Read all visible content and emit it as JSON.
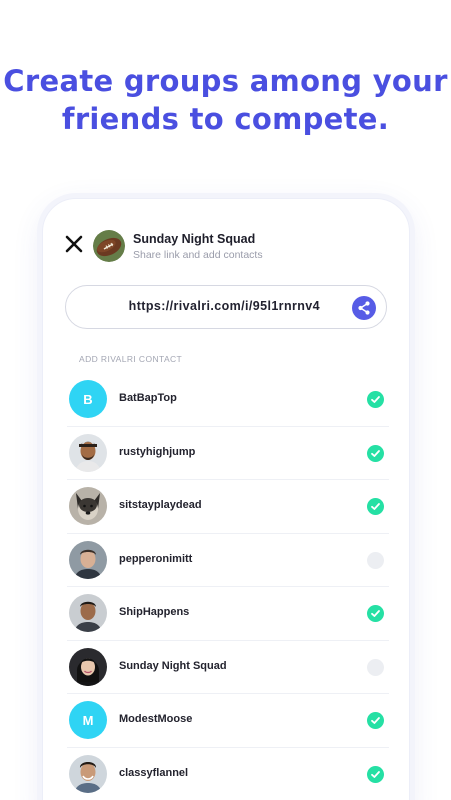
{
  "headline": {
    "line1": "Create groups among your",
    "line2": "friends to compete."
  },
  "group": {
    "name": "Sunday Night Squad",
    "subtitle": "Share link and add contacts",
    "avatar_icon": "football-icon"
  },
  "share_link": {
    "url": "https://rivalri.com/i/95l1rnrnv4",
    "share_icon": "share-icon"
  },
  "section_label": "ADD RIVALRI CONTACT",
  "colors": {
    "accent": "#4a4fe0",
    "check_on": "#25e0a4",
    "check_off": "#eceef2",
    "letter_avatar": "#2fd4f4"
  },
  "contacts": [
    {
      "name": "BatBapTop",
      "avatar_letter": "B",
      "avatar_type": "letter",
      "selected": true
    },
    {
      "name": "rustyhighjump",
      "avatar_type": "photo",
      "selected": true
    },
    {
      "name": "sitstayplaydead",
      "avatar_type": "dog-photo",
      "selected": true
    },
    {
      "name": "pepperonimitt",
      "avatar_type": "photo",
      "selected": false
    },
    {
      "name": "ShipHappens",
      "avatar_type": "photo",
      "selected": true
    },
    {
      "name": "Sunday Night Squad",
      "avatar_type": "photo",
      "selected": false
    },
    {
      "name": "ModestMoose",
      "avatar_letter": "M",
      "avatar_type": "letter",
      "selected": true
    },
    {
      "name": "classyflannel",
      "avatar_type": "photo",
      "selected": true
    }
  ]
}
